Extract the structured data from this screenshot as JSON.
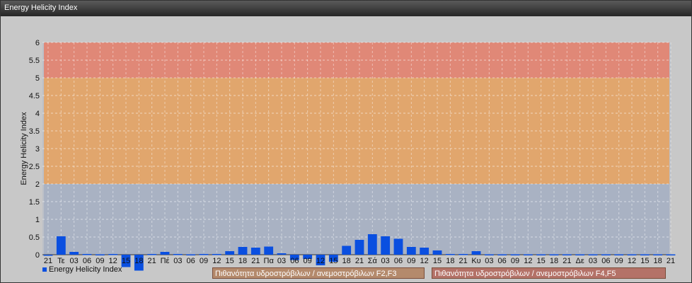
{
  "window": {
    "title": "Energy Helicity Index"
  },
  "chart_data": {
    "type": "bar",
    "title": "",
    "ylabel": "Energy Helicity Index",
    "xlabel": "",
    "ylim": [
      -0.5,
      6
    ],
    "yticks": [
      "0",
      "0.5",
      "1",
      "1.5",
      "2",
      "2.5",
      "3",
      "3.5",
      "4",
      "4.5",
      "5",
      "5.5",
      "6"
    ],
    "grid": true,
    "legend_position": "bottom-left",
    "xtick_labels": [
      "21",
      "Τε",
      "03",
      "06",
      "09",
      "12",
      "15",
      "18",
      "21",
      "Πέ",
      "03",
      "06",
      "09",
      "12",
      "15",
      "18",
      "21",
      "Πα",
      "03",
      "06",
      "09",
      "12",
      "15",
      "18",
      "21",
      "Σά",
      "03",
      "06",
      "09",
      "12",
      "15",
      "18",
      "21",
      "Κυ",
      "03",
      "06",
      "09",
      "12",
      "15",
      "18",
      "21",
      "Δε",
      "03",
      "06",
      "09",
      "12",
      "15",
      "18",
      "21"
    ],
    "bands": [
      {
        "from": 0,
        "to": 2,
        "color": "#a9b2c3"
      },
      {
        "from": 2,
        "to": 5,
        "color": "#e1a66d",
        "label": "Πιθανότητα υδροστρόβιλων / ανεμοστρόβιλων F2,F3"
      },
      {
        "from": 5,
        "to": 6,
        "color": "#e08877",
        "label": "Πιθανότητα υδροστρόβιλων / ανεμοστρόβιλων F4,F5"
      }
    ],
    "series": [
      {
        "name": "Energy Helicity Index",
        "color": "#0a4fe0",
        "values": [
          -0.02,
          0.52,
          0.08,
          0.02,
          0.01,
          0.02,
          -0.35,
          -0.45,
          0.02,
          0.08,
          0.02,
          0.01,
          0.02,
          0.02,
          0.1,
          0.22,
          0.2,
          0.23,
          0.04,
          -0.15,
          -0.12,
          -0.3,
          -0.2,
          0.25,
          0.42,
          0.58,
          0.52,
          0.45,
          0.22,
          0.2,
          0.12,
          0.02,
          0.02,
          0.1,
          0.01,
          0.01,
          0.01,
          0.01,
          0.01,
          0.01,
          0.01,
          0.01,
          0.01,
          0.01,
          0.01,
          0.01,
          0.01,
          0.01,
          0.01
        ]
      }
    ]
  }
}
